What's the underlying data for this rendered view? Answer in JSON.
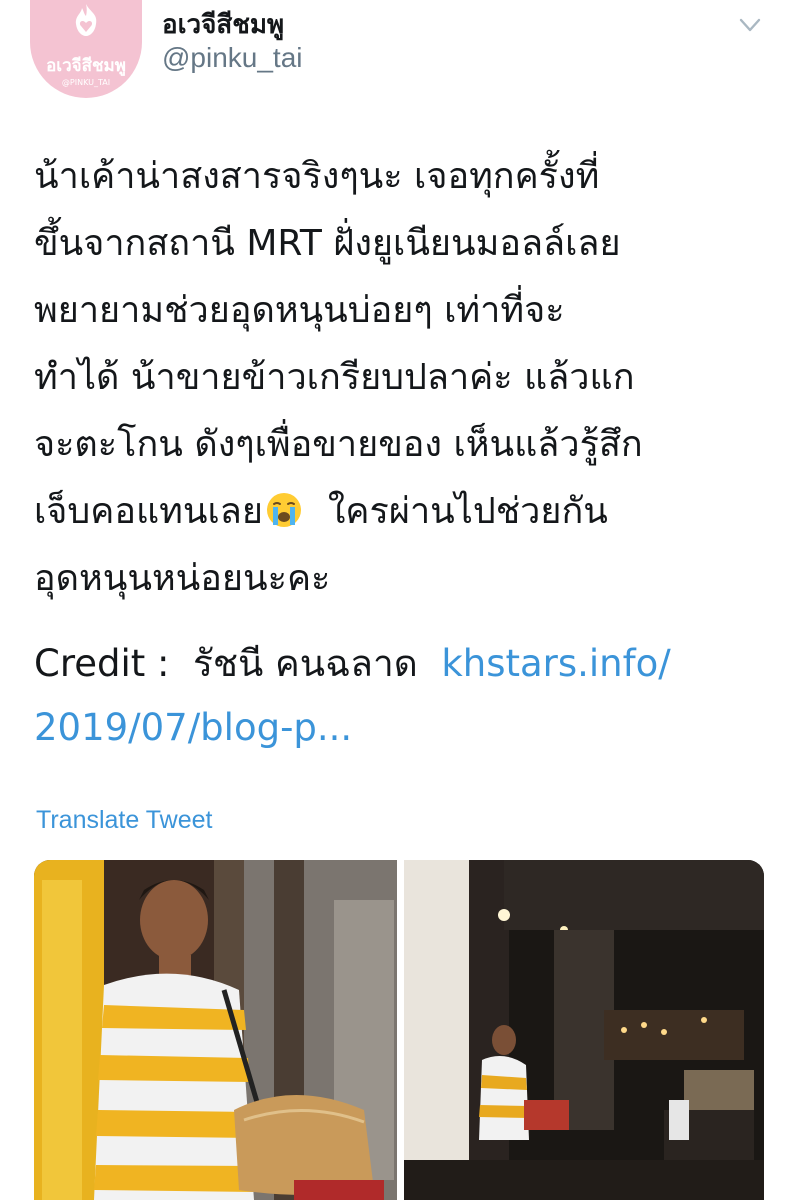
{
  "account": {
    "display_name": "อเวจีสีชมพู",
    "handle": "@pinku_tai",
    "avatar_text": "อเวจีสีชมพู",
    "avatar_handle": "@PINKU_TAI"
  },
  "tweet": {
    "lines": [
      "น้าเค้าน่าสงสารจริงๆนะ เจอทุกครั้งที่",
      "ขึ้นจากสถานี MRT ฝั่งยูเนียนมอลล์เลย",
      "พยายามช่วยอุดหนุนบ่อยๆ เท่าที่จะ",
      "ทำได้ น้าขายข้าวเกรียบปลาค่ะ แล้วแก",
      "จะตะโกน ดังๆเพื่อขายของ เห็นแล้วรู้สึก"
    ],
    "line6_before_emoji": "เจ็บคอแทนเลย",
    "line6_emoji": "crying-face-emoji",
    "line6_after_emoji": "  ใครผ่านไปช่วยกัน",
    "line7": "อุดหนุนหน่อยนะคะ",
    "credit_label": "Credit :  รัชนี คนฉลาด  ",
    "link_part1": "khstars.info/",
    "link_part2": "2019/07/blog-p..."
  },
  "translate_label": "Translate Tweet",
  "icons": {
    "menu": "chevron-down-icon",
    "avatar_logo": "flame-heart-icon"
  },
  "colors": {
    "link": "#3b94d9",
    "secondary_text": "#657786",
    "avatar_bg": "#f4c3d2"
  }
}
